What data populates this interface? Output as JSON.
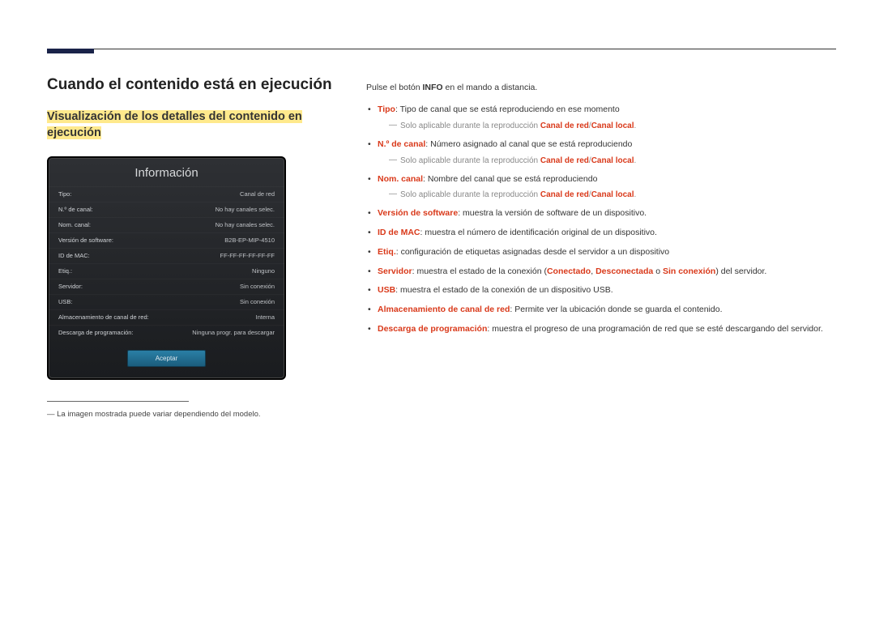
{
  "headings": {
    "h1": "Cuando el contenido está en ejecución",
    "h2": "Visualización de los detalles del contenido en ejecución"
  },
  "device": {
    "title": "Información",
    "rows": [
      {
        "l": "Tipo:",
        "r": "Canal de red"
      },
      {
        "l": "N.º de canal:",
        "r": "No hay canales selec."
      },
      {
        "l": "Nom. canal:",
        "r": "No hay canales selec."
      },
      {
        "l": "Versión de software:",
        "r": "B2B-EP-MIP-4510"
      },
      {
        "l": "ID de MAC:",
        "r": "FF-FF-FF-FF-FF-FF"
      },
      {
        "l": "Etiq.:",
        "r": "Ninguno"
      },
      {
        "l": "Servidor:",
        "r": "Sin conexión"
      },
      {
        "l": "USB:",
        "r": "Sin conexión"
      },
      {
        "l": "Almacenamiento de canal de red:",
        "r": "Interna"
      },
      {
        "l": "Descarga de programación:",
        "r": "Ninguna progr. para descargar"
      }
    ],
    "button": "Aceptar"
  },
  "footnote": "La imagen mostrada puede variar dependiendo del modelo.",
  "intro_pre": "Pulse el botón ",
  "intro_bold": "INFO",
  "intro_post": " en el mando a distancia.",
  "items": {
    "tipo_k": "Tipo",
    "tipo_v": ": Tipo de canal que se está reproduciendo en ese momento",
    "sub_std_pre": "Solo aplicable durante la reproducción ",
    "sub_std_red1": "Canal de red",
    "sub_std_sep": "/",
    "sub_std_red2": "Canal local",
    "sub_std_post": ".",
    "ncanal_k": "N.º de canal",
    "ncanal_v": ": Número asignado al canal que se está reproduciendo",
    "nom_k": "Nom. canal",
    "nom_v": ": Nombre del canal que se está reproduciendo",
    "ver_k": "Versión de software",
    "ver_v": ": muestra la versión de software de un dispositivo.",
    "mac_k": "ID de MAC",
    "mac_v": ": muestra el número de identificación original de un dispositivo.",
    "etiq_k": "Etiq.",
    "etiq_v": ": configuración de etiquetas asignadas desde el servidor a un dispositivo",
    "srv_k": "Servidor",
    "srv_pre": ": muestra el estado de la conexión (",
    "srv_c1": "Conectado",
    "srv_s1": ", ",
    "srv_c2": "Desconectada",
    "srv_s2": " o ",
    "srv_c3": "Sin conexión",
    "srv_post": ") del servidor.",
    "usb_k": "USB",
    "usb_v": ": muestra el estado de la conexión de un dispositivo USB.",
    "alm_k": "Almacenamiento de canal de red",
    "alm_v": ": Permite ver la ubicación donde se guarda el contenido.",
    "des_k": "Descarga de programación",
    "des_v": ": muestra el progreso de una programación de red que se esté descargando del servidor."
  }
}
